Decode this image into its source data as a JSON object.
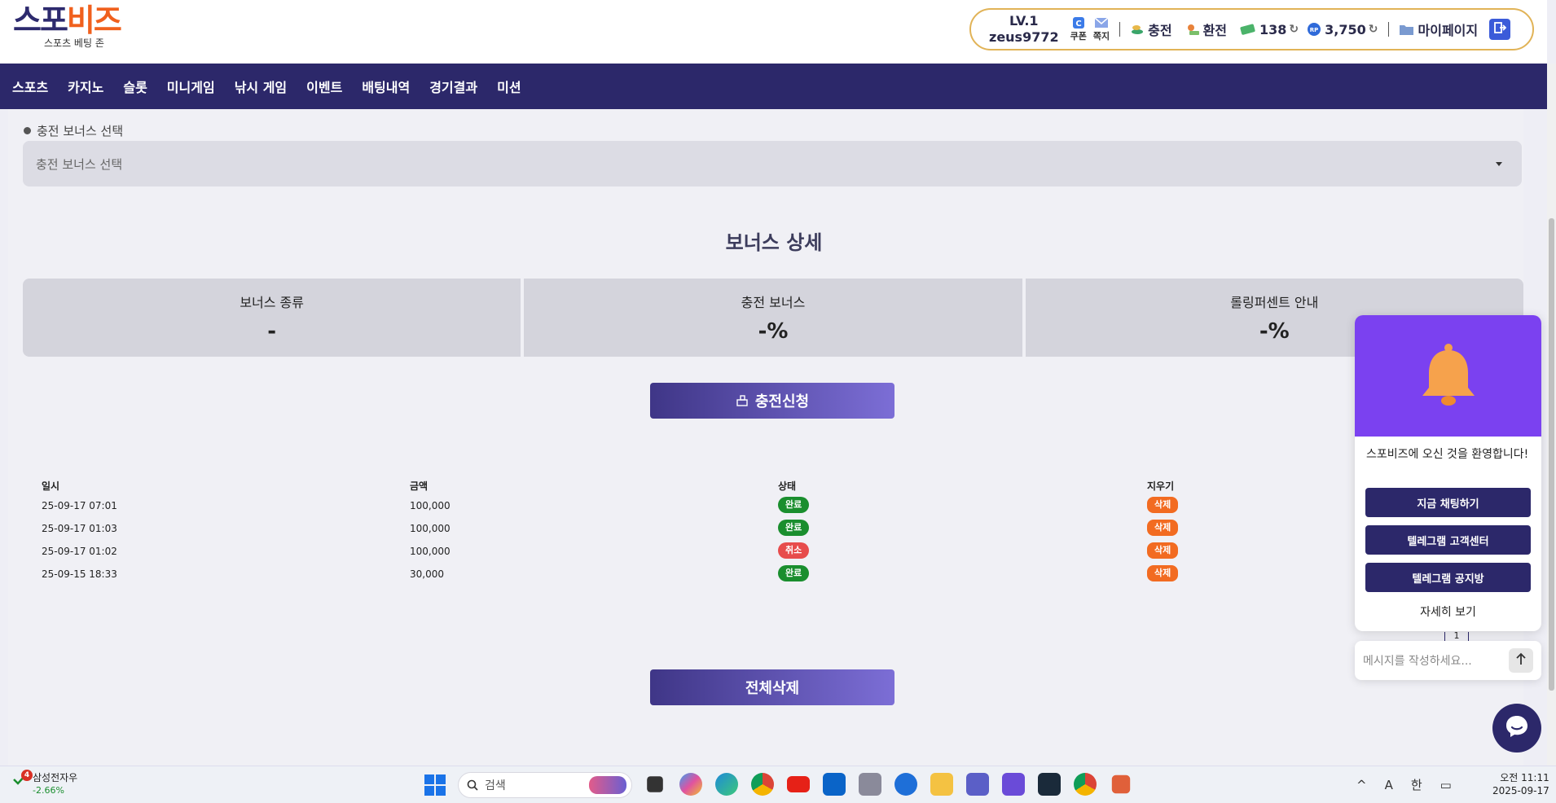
{
  "logo": {
    "part1": "스포",
    "part2": "비즈",
    "sub": "스포츠 베팅 존"
  },
  "user": {
    "level": "LV.1",
    "username": "zeus9772",
    "coupon_label": "쿠폰",
    "message_label": "쪽지",
    "charge_label": "충전",
    "exchange_label": "환전",
    "money": "138",
    "points": "3,750",
    "mypage_label": "마이페이지"
  },
  "nav": {
    "items": [
      "스포츠",
      "카지노",
      "슬롯",
      "미니게임",
      "낚시 게임",
      "이벤트",
      "배팅내역",
      "경기결과",
      "미션"
    ]
  },
  "bonus_select": {
    "label": "충전 보너스 선택",
    "placeholder": "충전 보너스 선택"
  },
  "bonus_detail": {
    "title": "보너스 상세",
    "cells": [
      {
        "label": "보너스 종류",
        "value": "-"
      },
      {
        "label": "충전 보너스",
        "value": "-%"
      },
      {
        "label": "롤링퍼센트 안내",
        "value": "-%"
      }
    ]
  },
  "charge_button": "충전신청",
  "history": {
    "headers": [
      "일시",
      "금액",
      "상태",
      "지우기"
    ],
    "rows": [
      {
        "date": "25-09-17 07:01",
        "amount": "100,000",
        "status": "완료",
        "action": "삭제"
      },
      {
        "date": "25-09-17 01:03",
        "amount": "100,000",
        "status": "완료",
        "action": "삭제"
      },
      {
        "date": "25-09-17 01:02",
        "amount": "100,000",
        "status": "취소",
        "action": "삭제"
      },
      {
        "date": "25-09-15 18:33",
        "amount": "30,000",
        "status": "완료",
        "action": "삭제"
      }
    ],
    "page": "1"
  },
  "delete_all_button": "전체삭제",
  "chat": {
    "welcome": "스포비즈에 오신 것을 환영합니다!",
    "buttons": [
      "지금 채팅하기",
      "텔레그램 고객센터",
      "텔레그램 공지방"
    ],
    "more": "자세히 보기",
    "message_placeholder": "메시지를 작성하세요..."
  },
  "taskbar": {
    "stock_name": "삼성전자우",
    "stock_change": "-2.66%",
    "stock_badge": "4",
    "search_placeholder": "검색",
    "ime1": "A",
    "ime2": "한",
    "time": "오전 11:11",
    "date": "2025-09-17"
  },
  "colors": {
    "navy": "#2c286a",
    "orange": "#f0601d",
    "gold": "#e1b357",
    "chat_purple": "#7b41f0"
  }
}
